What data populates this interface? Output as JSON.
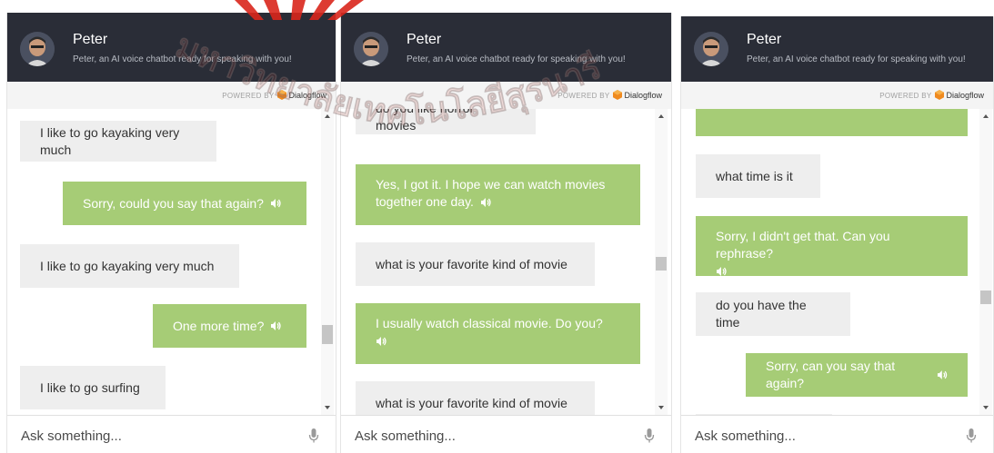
{
  "bot": {
    "name": "Peter",
    "description": "Peter, an AI voice chatbot ready for speaking with you!"
  },
  "powered_by": {
    "prefix": "POWERED BY",
    "brand": "Dialogflow"
  },
  "input": {
    "placeholder": "Ask something..."
  },
  "watermark": {
    "text": "มหาวิทยาลัยเทคโนโลยีสุรนารี"
  },
  "colors": {
    "header_bg": "#2a2d37",
    "bot_bubble": "#a6cc76",
    "user_bubble": "#eeeeee",
    "watermark": "#d9261c"
  },
  "panels": [
    {
      "messages": [
        {
          "sender": "user",
          "text": "I like to go kayaking very much"
        },
        {
          "sender": "bot",
          "text": "Sorry, could you say that again?",
          "icon": "speaker-icon"
        },
        {
          "sender": "user",
          "text": "I like to go kayaking very much"
        },
        {
          "sender": "bot",
          "text": "One more time?",
          "icon": "speaker-icon"
        },
        {
          "sender": "user",
          "text": "I like to go surfing"
        }
      ]
    },
    {
      "messages": [
        {
          "sender": "user",
          "text": "do you like horror movies"
        },
        {
          "sender": "bot",
          "text": "Yes, I got it. I hope we can watch movies together one day.",
          "icon": "speaker-icon"
        },
        {
          "sender": "user",
          "text": "what is your favorite kind of movie"
        },
        {
          "sender": "bot",
          "text": "I usually watch classical movie. Do you?",
          "icon": "speaker-icon"
        },
        {
          "sender": "user",
          "text": "what is your favorite kind of movie"
        }
      ]
    },
    {
      "messages": [
        {
          "sender": "bot",
          "text": "",
          "icon": "speaker-icon"
        },
        {
          "sender": "user",
          "text": "what time is it"
        },
        {
          "sender": "bot",
          "text": "Sorry, I didn't get that. Can you rephrase?",
          "icon": "speaker-icon"
        },
        {
          "sender": "user",
          "text": "do you have the time"
        },
        {
          "sender": "bot",
          "text": "Sorry, can you say that again?",
          "icon": "speaker-icon"
        },
        {
          "sender": "user",
          "text": ""
        }
      ]
    }
  ]
}
